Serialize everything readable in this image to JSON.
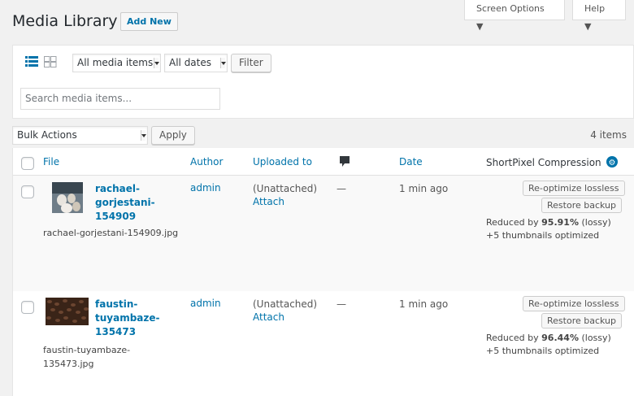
{
  "header": {
    "title": "Media Library",
    "add_new": "Add New",
    "screen_options": "Screen Options ▼",
    "help": "Help ▼"
  },
  "filters": {
    "media_type": "All media items",
    "dates": "All dates",
    "filter_button": "Filter",
    "search_placeholder": "Search media items..."
  },
  "bulk": {
    "action": "Bulk Actions",
    "apply": "Apply",
    "items_count": "4 items"
  },
  "table": {
    "columns": {
      "file": "File",
      "author": "Author",
      "uploaded_to": "Uploaded to",
      "comments_icon": "comment-icon",
      "date": "Date",
      "compression": "ShortPixel Compression"
    },
    "rows": [
      {
        "title_line1": "rachael-",
        "title_line2": "gorjestani-",
        "title_line3": "154909",
        "filename": "rachael-gorjestani-154909.jpg",
        "author": "admin",
        "uploaded": "(Unattached)",
        "attach": "Attach",
        "comments": "—",
        "date": "1 min ago",
        "reoptimize": "Re-optimize lossless",
        "restore": "Restore backup",
        "reduced_prefix": "Reduced by ",
        "reduced_pct": "95.91%",
        "reduced_suffix": " (lossy)",
        "thumbs": "+5 thumbnails optimized"
      },
      {
        "title_line1": "faustin-",
        "title_line2": "tuyambaze-",
        "title_line3": "135473",
        "filename_line1": "faustin-tuyambaze-",
        "filename_line2": "135473.jpg",
        "author": "admin",
        "uploaded": "(Unattached)",
        "attach": "Attach",
        "comments": "—",
        "date": "1 min ago",
        "reoptimize": "Re-optimize lossless",
        "restore": "Restore backup",
        "reduced_prefix": "Reduced by ",
        "reduced_pct": "96.44%",
        "reduced_suffix": " (lossy)",
        "thumbs": "+5 thumbnails optimized"
      }
    ]
  },
  "colors": {
    "link": "#0073aa",
    "background": "#f1f1f1"
  }
}
